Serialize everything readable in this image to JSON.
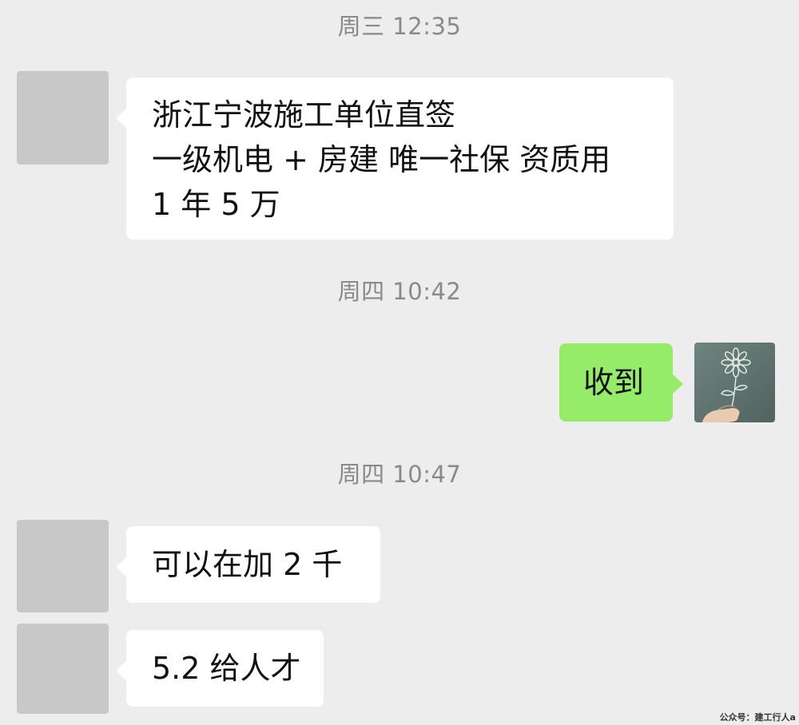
{
  "timestamps": [
    "周三 12:35",
    "周四 10:42",
    "周四 10:47"
  ],
  "messages": [
    {
      "sender": "contact",
      "lines": [
        "浙江宁波施工单位直签",
        "一级机电 + 房建 唯一社保 资质用",
        "1 年 5 万"
      ]
    },
    {
      "sender": "self",
      "text": "收到"
    },
    {
      "sender": "contact",
      "text": "可以在加 2 千"
    },
    {
      "sender": "contact",
      "text": "5.2 给人才"
    }
  ],
  "avatars": {
    "self_icon": "flower-drawing-avatar-icon"
  },
  "colors": {
    "background": "#ededed",
    "incoming_bubble": "#ffffff",
    "outgoing_bubble": "#95ec69",
    "avatar_placeholder": "#c8c8c8",
    "timestamp_text": "#8a8a8a"
  },
  "watermark": "公众号：建工行人a"
}
